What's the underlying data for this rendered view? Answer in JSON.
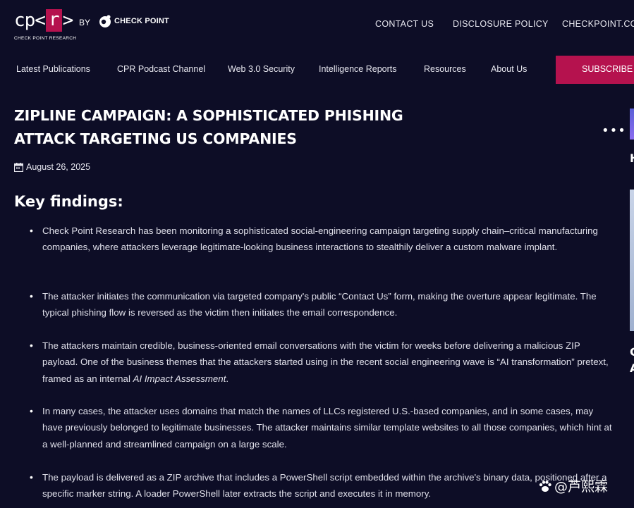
{
  "header": {
    "logo_sub": "CHECK POINT RESEARCH",
    "by": "BY",
    "partner_logo_text": "CHECK POINT",
    "links": [
      {
        "label": "CONTACT US"
      },
      {
        "label": "DISCLOSURE POLICY"
      },
      {
        "label": "CHECKPOINT.COM"
      }
    ]
  },
  "nav": {
    "items": [
      {
        "label": "Latest Publications"
      },
      {
        "label": "CPR Podcast Channel"
      },
      {
        "label": "Web 3.0 Security"
      },
      {
        "label": "Intelligence Reports"
      },
      {
        "label": "Resources"
      },
      {
        "label": "About Us"
      }
    ],
    "subscribe": "SUBSCRIBE"
  },
  "article": {
    "title": "ZIPLINE CAMPAIGN: A SOPHISTICATED PHISHING ATTACK TARGETING US COMPANIES",
    "more_icon": "more-horizontal-icon",
    "date": "August 26, 2025",
    "section_heading": "Key findings:",
    "findings": [
      "Check Point Research has been monitoring a sophisticated social-engineering campaign targeting supply chain–critical manufacturing companies, where attackers leverage legitimate-looking business interactions to stealthily deliver a custom malware implant.",
      "The attacker initiates the communication via targeted company's public “Contact Us” form, making the overture appear legitimate. The typical phishing flow is reversed as the victim then initiates the email correspondence.",
      "In many cases, the attacker uses domains that match the names of LLCs registered U.S.-based companies, and in some cases, may have previously belonged to legitimate businesses. The attacker maintains similar template websites to all those companies, which hint at a well-planned and streamlined campaign on a large scale.",
      "The payload is delivered as a ZIP archive that includes a PowerShell script embedded within the archive's binary data, positioned after a specific marker string. A loader PowerShell later extracts the script and executes it in memory."
    ],
    "finding_3": {
      "text": "The attackers maintain credible, business-oriented email conversations with the victim for weeks before delivering a malicious ZIP payload. One of the business themes that the attackers started using in the recent social engineering wave is “AI transformation” pretext, framed as an internal ",
      "emphasis": "AI Impact Assessment",
      "tail": "."
    }
  },
  "sidebar": {
    "heading_fragment_1": "H",
    "heading_fragment_2_line1": "C",
    "heading_fragment_2_line2": "A"
  },
  "watermark": {
    "text": "@芦熙霖"
  },
  "colors": {
    "background": "#0d0d26",
    "accent": "#b5124e",
    "text": "#e8e8f0"
  }
}
